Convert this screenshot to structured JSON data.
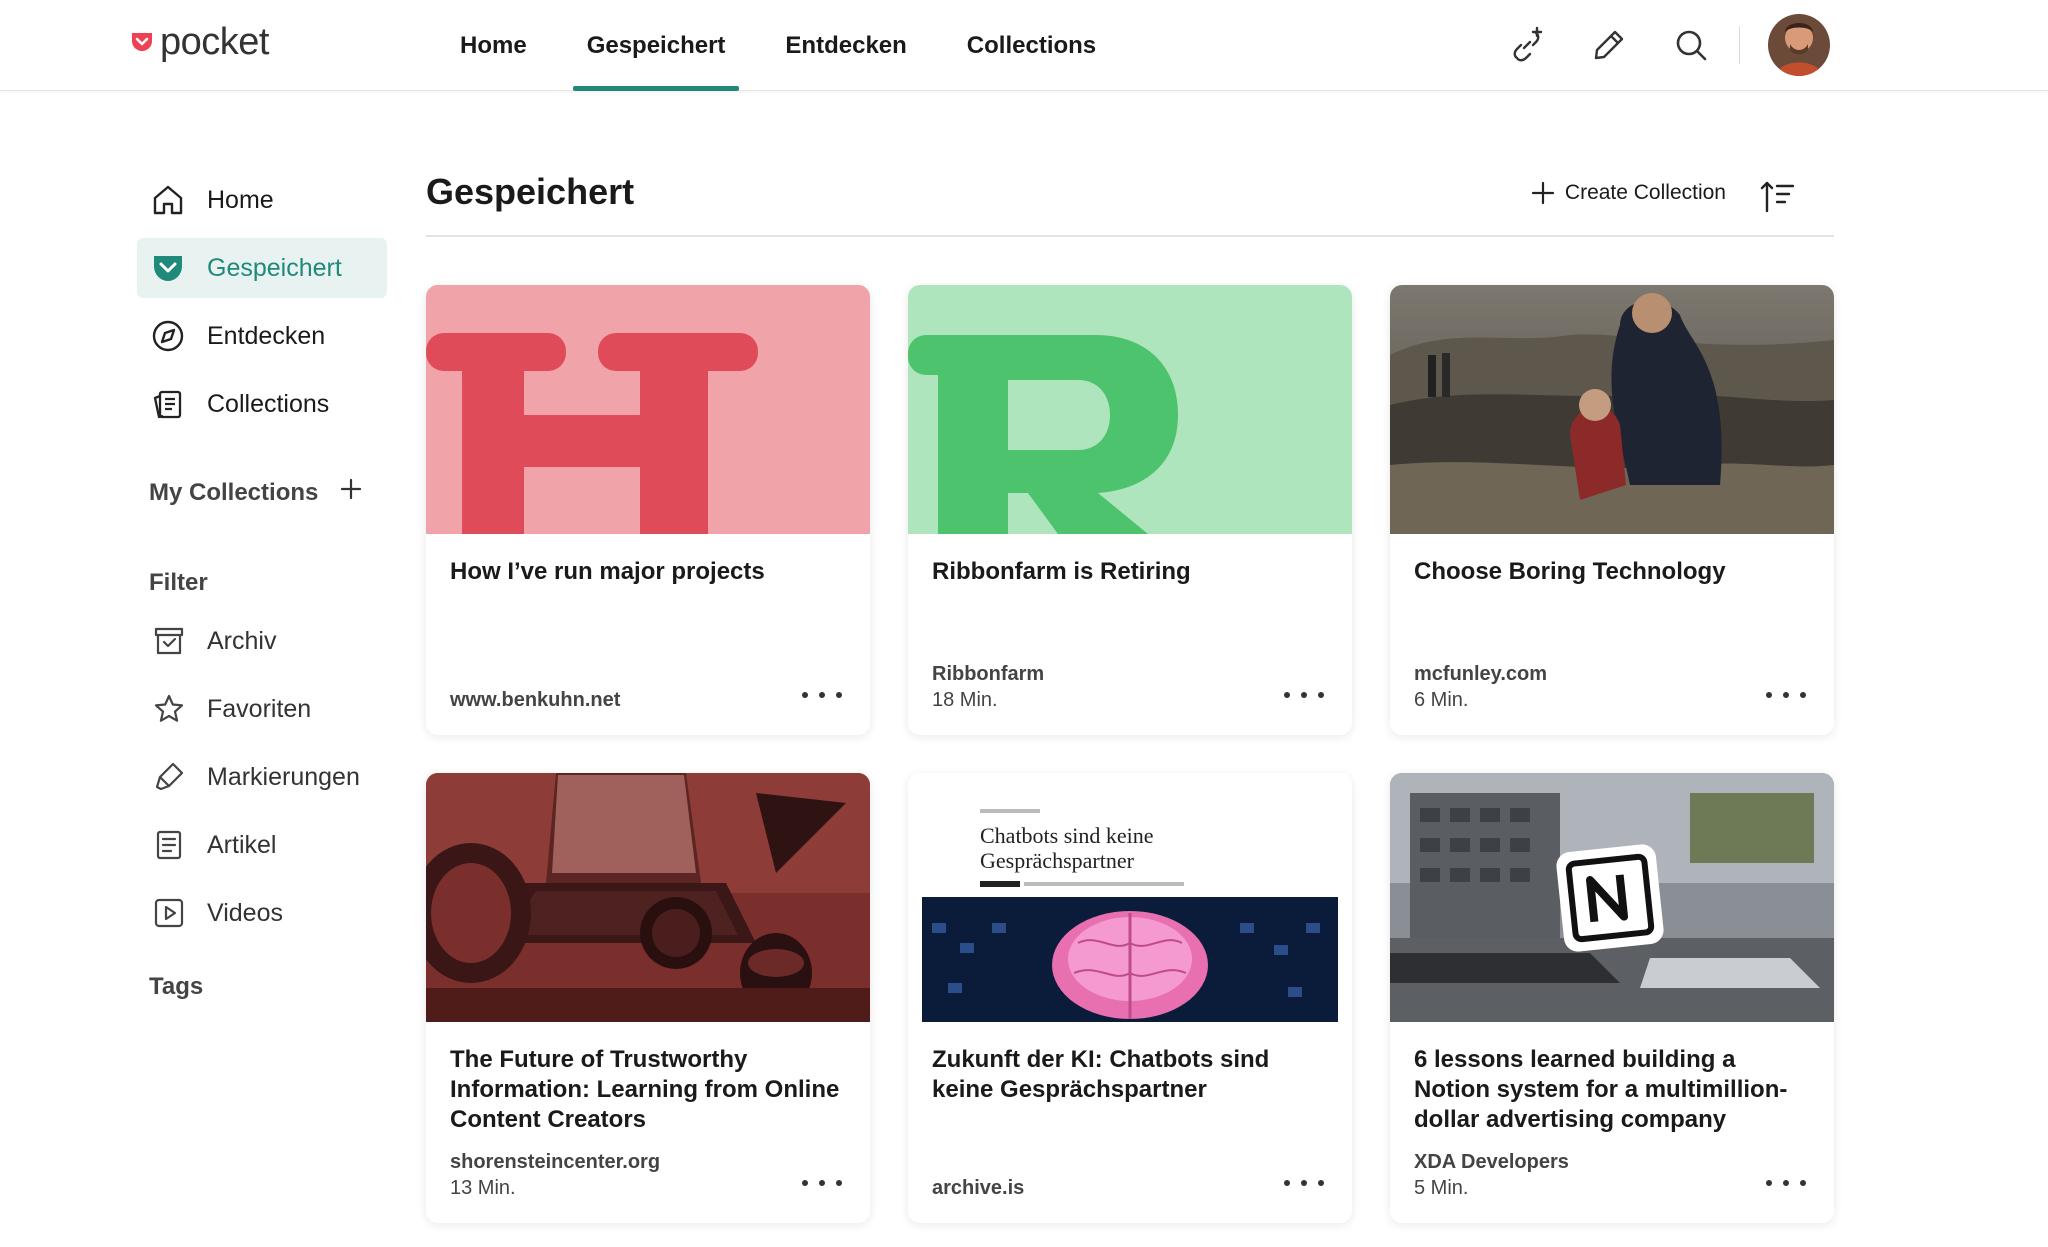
{
  "app": {
    "logo_text": "pocket",
    "brand_color": "#ef4056",
    "accent_color": "#1f8a7a"
  },
  "nav": {
    "tabs": [
      {
        "label": "Home"
      },
      {
        "label": "Gespeichert",
        "active": true
      },
      {
        "label": "Entdecken"
      },
      {
        "label": "Collections"
      }
    ],
    "icons": [
      "add-link-icon",
      "highlight-pen-icon",
      "search-icon",
      "avatar"
    ]
  },
  "sidebar": {
    "items": [
      {
        "label": "Home",
        "icon": "home-icon"
      },
      {
        "label": "Gespeichert",
        "icon": "pocket-save-icon",
        "active": true
      },
      {
        "label": "Entdecken",
        "icon": "discover-compass-icon"
      },
      {
        "label": "Collections",
        "icon": "collections-icon"
      }
    ],
    "my_collections_label": "My Collections",
    "filter_label": "Filter",
    "filters": [
      {
        "label": "Archiv",
        "icon": "archive-icon"
      },
      {
        "label": "Favoriten",
        "icon": "star-icon"
      },
      {
        "label": "Markierungen",
        "icon": "highlighter-icon"
      },
      {
        "label": "Artikel",
        "icon": "article-icon"
      },
      {
        "label": "Videos",
        "icon": "video-icon"
      }
    ],
    "tags_label": "Tags"
  },
  "main": {
    "title": "Gespeichert",
    "create_collection_label": "Create Collection"
  },
  "cards": [
    {
      "title": "How I’ve run major projects",
      "source": "www.benkuhn.net",
      "time": "",
      "thumb_letter": "H"
    },
    {
      "title": "Ribbonfarm is Retiring",
      "source": "Ribbonfarm",
      "time": "18 Min.",
      "thumb_letter": "R"
    },
    {
      "title": "Choose Boring Technology",
      "source": "mcfunley.com",
      "time": "6 Min."
    },
    {
      "title": "The Future of Trustworthy Information: Learning from Online Content Creators",
      "source": "shorensteincenter.org",
      "time": "13 Min."
    },
    {
      "title": "Zukunft der KI: Chatbots sind keine Gesprächspartner",
      "source": "archive.is",
      "time": "",
      "thumb_headline": "Chatbots sind keine Gesprächspartner"
    },
    {
      "title": "6 lessons learned building a Notion system for a multimillion-dollar advertising company",
      "source": "XDA Developers",
      "time": "5 Min.",
      "thumb_letter": "N"
    }
  ]
}
